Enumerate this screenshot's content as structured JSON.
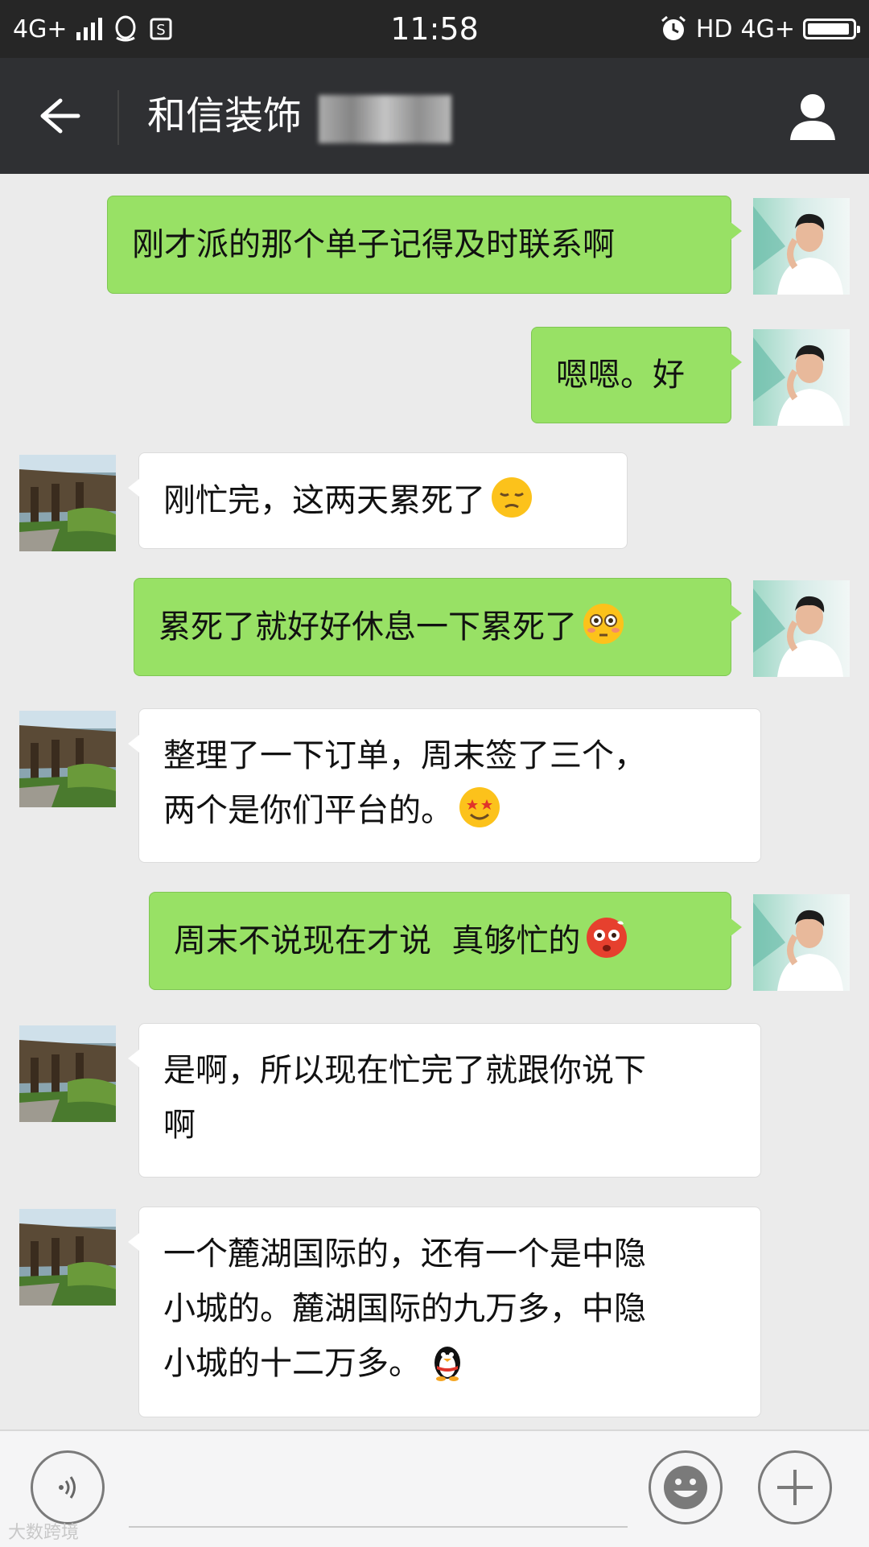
{
  "status_bar": {
    "network_left": "4G+",
    "time": "11:58",
    "hd": "HD",
    "network_right": "4G+",
    "battery_level": 0.95
  },
  "header": {
    "title": "和信装饰"
  },
  "messages": [
    {
      "side": "out",
      "text": "刚才派的那个单子记得及时联系啊"
    },
    {
      "side": "out",
      "text": "嗯嗯。好"
    },
    {
      "side": "in",
      "text": "刚忙完，这两天累死了",
      "emoji": "pensive-face-emoji"
    },
    {
      "side": "out",
      "text": "累死了就好好休息一下累死了",
      "emoji": "flushed-face-emoji"
    },
    {
      "side": "in",
      "lines": [
        "整理了一下订单，周末签了三个，",
        "两个是你们平台的。"
      ],
      "emoji": "star-struck-face-emoji"
    },
    {
      "side": "out",
      "text": "周末不说现在才说  真够忙的",
      "emoji": "dizzy-red-face-emoji"
    },
    {
      "side": "in",
      "lines": [
        "是啊，所以现在忙完了就跟你说下",
        "啊"
      ]
    },
    {
      "side": "in",
      "lines": [
        "一个麓湖国际的，还有一个是中隐",
        "小城的。麓湖国际的九万多，中隐",
        "小城的十二万多。"
      ],
      "emoji": "penguin-emoji"
    }
  ],
  "bottom_bar": {
    "voice_icon": "voice-input-icon",
    "emoji_icon": "smiley-icon",
    "plus_icon": "plus-icon"
  },
  "watermark": "大数跨境",
  "colors": {
    "status_bg": "#262626",
    "title_bg": "#2f3033",
    "chat_bg": "#ebebeb",
    "outgoing_bubble": "#98e165",
    "incoming_bubble": "#ffffff"
  }
}
